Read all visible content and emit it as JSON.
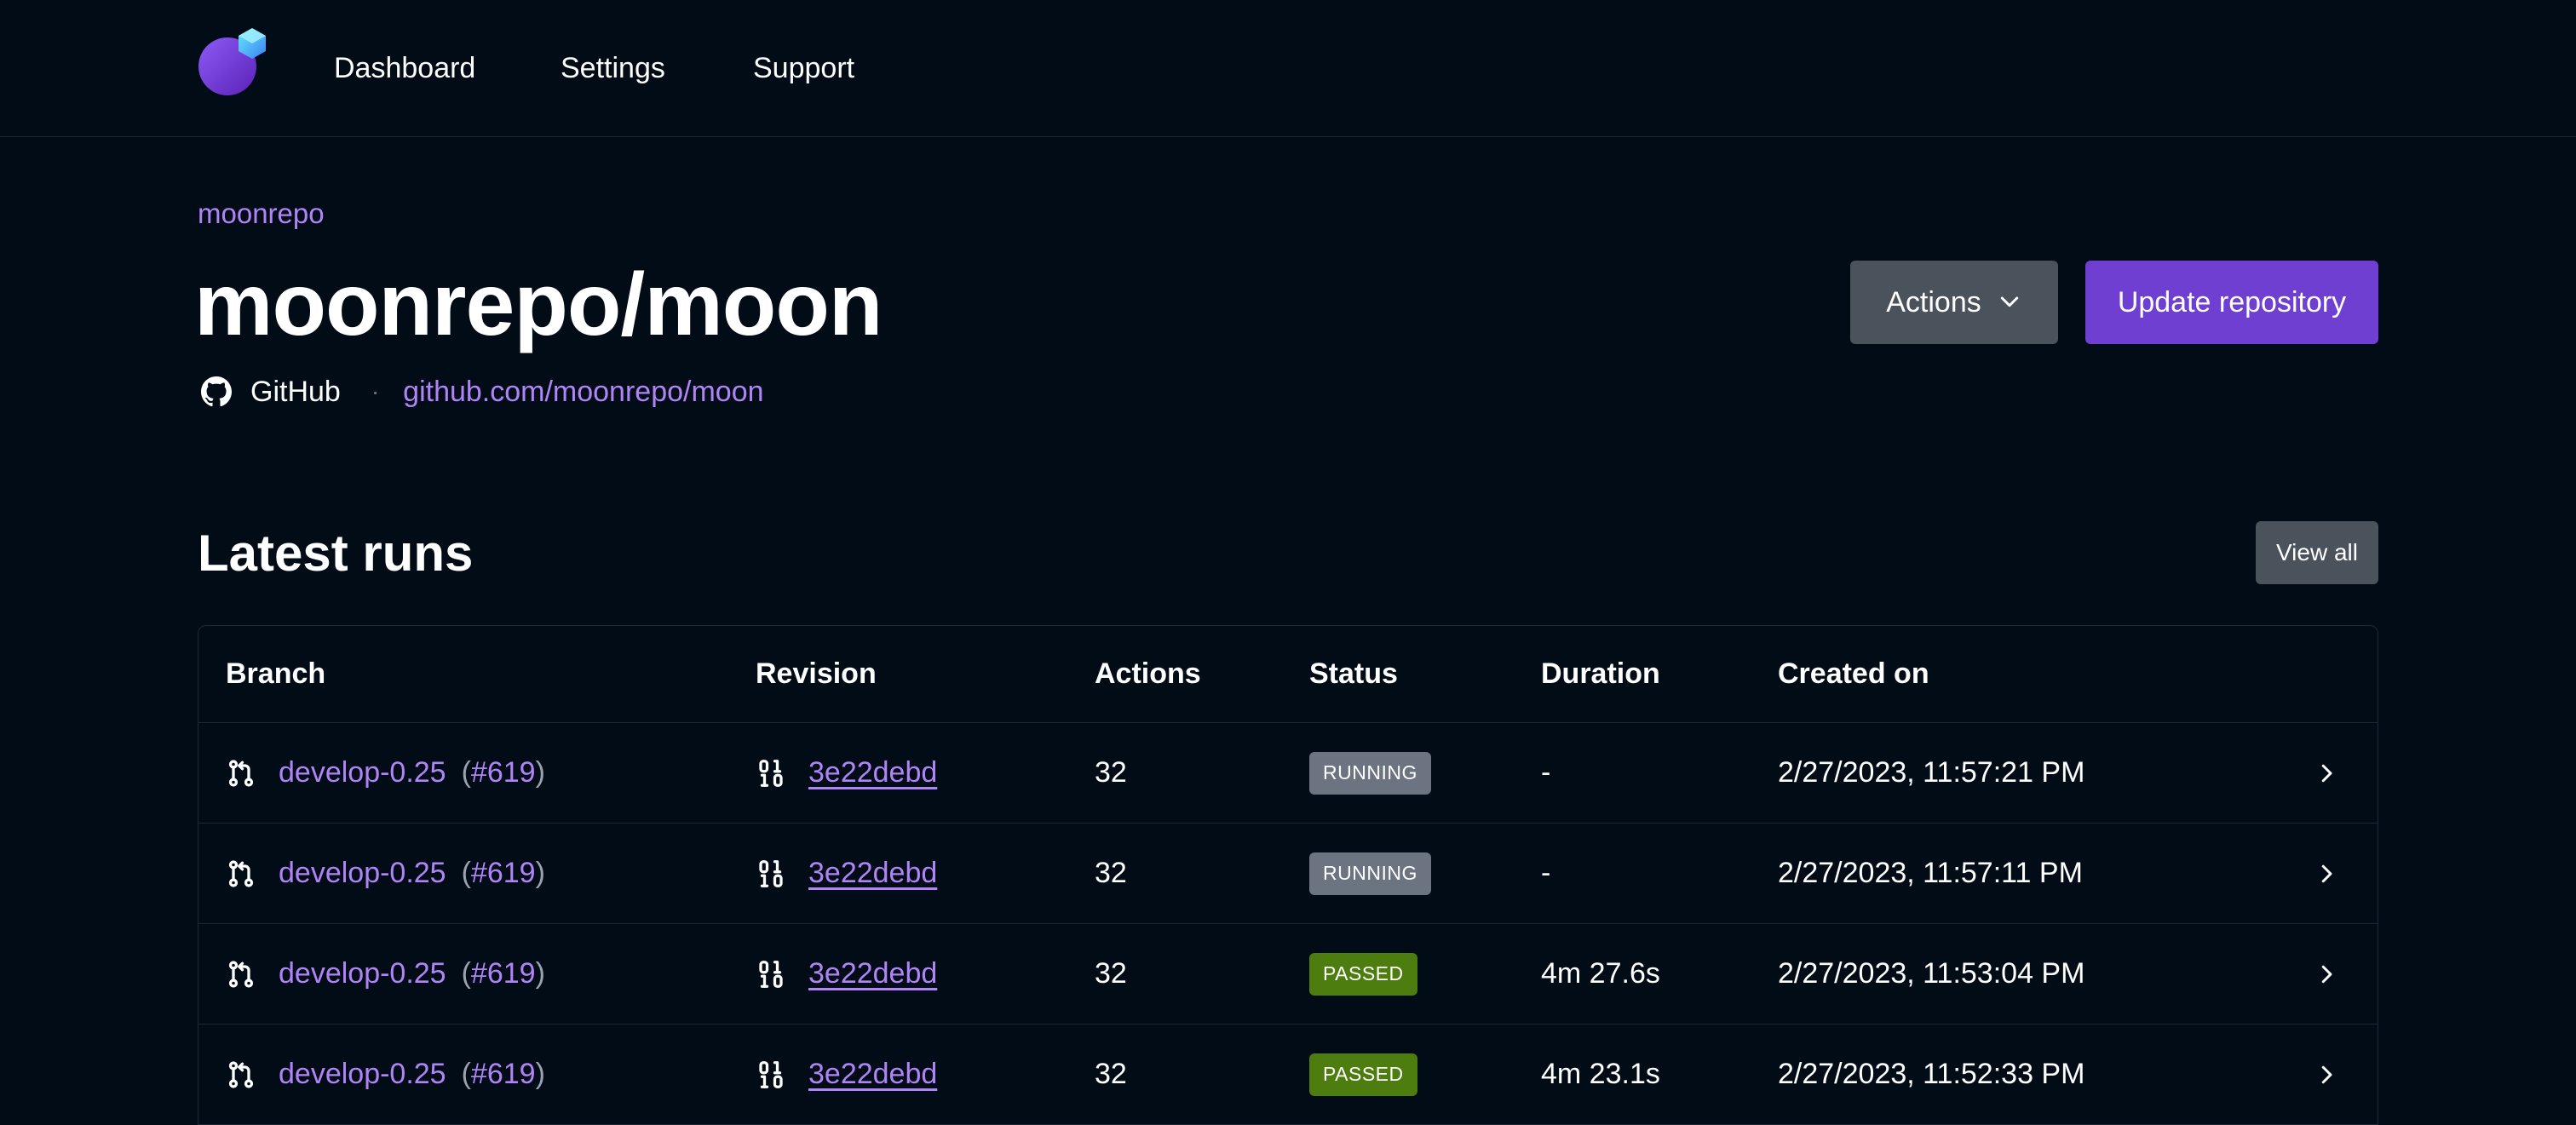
{
  "nav": {
    "logo_name": "moon-logo",
    "links": [
      "Dashboard",
      "Settings",
      "Support"
    ]
  },
  "header": {
    "org": "moonrepo",
    "repo_title": "moonrepo/moon",
    "provider": "GitHub",
    "separator": "·",
    "repo_url": "github.com/moonrepo/moon",
    "actions_label": "Actions",
    "update_label": "Update repository"
  },
  "runs": {
    "title": "Latest runs",
    "view_all_label": "View all",
    "columns": [
      "Branch",
      "Revision",
      "Actions",
      "Status",
      "Duration",
      "Created on"
    ],
    "rows": [
      {
        "branch": "develop-0.25",
        "pr": "#619",
        "revision": "3e22debd",
        "actions": "32",
        "status": "RUNNING",
        "duration": "-",
        "created": "2/27/2023, 11:57:21 PM"
      },
      {
        "branch": "develop-0.25",
        "pr": "#619",
        "revision": "3e22debd",
        "actions": "32",
        "status": "RUNNING",
        "duration": "-",
        "created": "2/27/2023, 11:57:11 PM"
      },
      {
        "branch": "develop-0.25",
        "pr": "#619",
        "revision": "3e22debd",
        "actions": "32",
        "status": "PASSED",
        "duration": "4m 27.6s",
        "created": "2/27/2023, 11:53:04 PM"
      },
      {
        "branch": "develop-0.25",
        "pr": "#619",
        "revision": "3e22debd",
        "actions": "32",
        "status": "PASSED",
        "duration": "4m 23.1s",
        "created": "2/27/2023, 11:52:33 PM"
      }
    ]
  },
  "colors": {
    "background": "#020c17",
    "accent": "#b084f5",
    "primary_button": "#6e3fd1",
    "secondary_button": "#4a525c",
    "status_running": "#6b7480",
    "status_passed": "#4d7c0f"
  },
  "icons": {
    "provider": "github-icon",
    "branch": "git-pull-request-icon",
    "revision": "binary-icon",
    "dropdown": "chevron-down-icon",
    "row_link": "chevron-right-icon"
  }
}
